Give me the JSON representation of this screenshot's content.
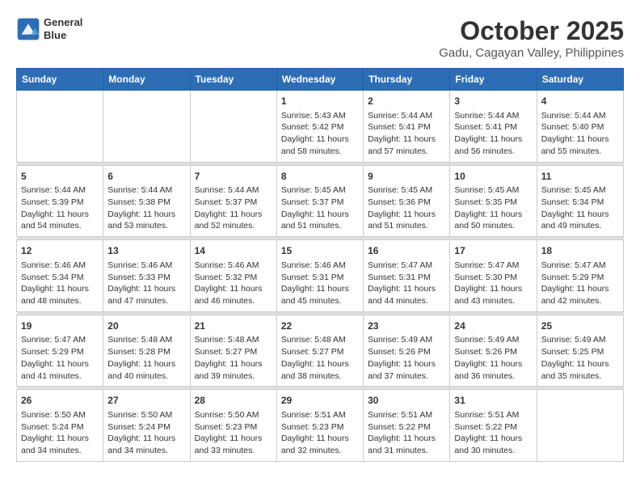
{
  "header": {
    "logo_line1": "General",
    "logo_line2": "Blue",
    "title": "October 2025",
    "subtitle": "Gadu, Cagayan Valley, Philippines"
  },
  "days_of_week": [
    "Sunday",
    "Monday",
    "Tuesday",
    "Wednesday",
    "Thursday",
    "Friday",
    "Saturday"
  ],
  "weeks": [
    {
      "days": [
        {
          "num": "",
          "info": ""
        },
        {
          "num": "",
          "info": ""
        },
        {
          "num": "",
          "info": ""
        },
        {
          "num": "1",
          "info": "Sunrise: 5:43 AM\nSunset: 5:42 PM\nDaylight: 11 hours\nand 58 minutes."
        },
        {
          "num": "2",
          "info": "Sunrise: 5:44 AM\nSunset: 5:41 PM\nDaylight: 11 hours\nand 57 minutes."
        },
        {
          "num": "3",
          "info": "Sunrise: 5:44 AM\nSunset: 5:41 PM\nDaylight: 11 hours\nand 56 minutes."
        },
        {
          "num": "4",
          "info": "Sunrise: 5:44 AM\nSunset: 5:40 PM\nDaylight: 11 hours\nand 55 minutes."
        }
      ]
    },
    {
      "days": [
        {
          "num": "5",
          "info": "Sunrise: 5:44 AM\nSunset: 5:39 PM\nDaylight: 11 hours\nand 54 minutes."
        },
        {
          "num": "6",
          "info": "Sunrise: 5:44 AM\nSunset: 5:38 PM\nDaylight: 11 hours\nand 53 minutes."
        },
        {
          "num": "7",
          "info": "Sunrise: 5:44 AM\nSunset: 5:37 PM\nDaylight: 11 hours\nand 52 minutes."
        },
        {
          "num": "8",
          "info": "Sunrise: 5:45 AM\nSunset: 5:37 PM\nDaylight: 11 hours\nand 51 minutes."
        },
        {
          "num": "9",
          "info": "Sunrise: 5:45 AM\nSunset: 5:36 PM\nDaylight: 11 hours\nand 51 minutes."
        },
        {
          "num": "10",
          "info": "Sunrise: 5:45 AM\nSunset: 5:35 PM\nDaylight: 11 hours\nand 50 minutes."
        },
        {
          "num": "11",
          "info": "Sunrise: 5:45 AM\nSunset: 5:34 PM\nDaylight: 11 hours\nand 49 minutes."
        }
      ]
    },
    {
      "days": [
        {
          "num": "12",
          "info": "Sunrise: 5:46 AM\nSunset: 5:34 PM\nDaylight: 11 hours\nand 48 minutes."
        },
        {
          "num": "13",
          "info": "Sunrise: 5:46 AM\nSunset: 5:33 PM\nDaylight: 11 hours\nand 47 minutes."
        },
        {
          "num": "14",
          "info": "Sunrise: 5:46 AM\nSunset: 5:32 PM\nDaylight: 11 hours\nand 46 minutes."
        },
        {
          "num": "15",
          "info": "Sunrise: 5:46 AM\nSunset: 5:31 PM\nDaylight: 11 hours\nand 45 minutes."
        },
        {
          "num": "16",
          "info": "Sunrise: 5:47 AM\nSunset: 5:31 PM\nDaylight: 11 hours\nand 44 minutes."
        },
        {
          "num": "17",
          "info": "Sunrise: 5:47 AM\nSunset: 5:30 PM\nDaylight: 11 hours\nand 43 minutes."
        },
        {
          "num": "18",
          "info": "Sunrise: 5:47 AM\nSunset: 5:29 PM\nDaylight: 11 hours\nand 42 minutes."
        }
      ]
    },
    {
      "days": [
        {
          "num": "19",
          "info": "Sunrise: 5:47 AM\nSunset: 5:29 PM\nDaylight: 11 hours\nand 41 minutes."
        },
        {
          "num": "20",
          "info": "Sunrise: 5:48 AM\nSunset: 5:28 PM\nDaylight: 11 hours\nand 40 minutes."
        },
        {
          "num": "21",
          "info": "Sunrise: 5:48 AM\nSunset: 5:27 PM\nDaylight: 11 hours\nand 39 minutes."
        },
        {
          "num": "22",
          "info": "Sunrise: 5:48 AM\nSunset: 5:27 PM\nDaylight: 11 hours\nand 38 minutes."
        },
        {
          "num": "23",
          "info": "Sunrise: 5:49 AM\nSunset: 5:26 PM\nDaylight: 11 hours\nand 37 minutes."
        },
        {
          "num": "24",
          "info": "Sunrise: 5:49 AM\nSunset: 5:26 PM\nDaylight: 11 hours\nand 36 minutes."
        },
        {
          "num": "25",
          "info": "Sunrise: 5:49 AM\nSunset: 5:25 PM\nDaylight: 11 hours\nand 35 minutes."
        }
      ]
    },
    {
      "days": [
        {
          "num": "26",
          "info": "Sunrise: 5:50 AM\nSunset: 5:24 PM\nDaylight: 11 hours\nand 34 minutes."
        },
        {
          "num": "27",
          "info": "Sunrise: 5:50 AM\nSunset: 5:24 PM\nDaylight: 11 hours\nand 34 minutes."
        },
        {
          "num": "28",
          "info": "Sunrise: 5:50 AM\nSunset: 5:23 PM\nDaylight: 11 hours\nand 33 minutes."
        },
        {
          "num": "29",
          "info": "Sunrise: 5:51 AM\nSunset: 5:23 PM\nDaylight: 11 hours\nand 32 minutes."
        },
        {
          "num": "30",
          "info": "Sunrise: 5:51 AM\nSunset: 5:22 PM\nDaylight: 11 hours\nand 31 minutes."
        },
        {
          "num": "31",
          "info": "Sunrise: 5:51 AM\nSunset: 5:22 PM\nDaylight: 11 hours\nand 30 minutes."
        },
        {
          "num": "",
          "info": ""
        }
      ]
    }
  ]
}
